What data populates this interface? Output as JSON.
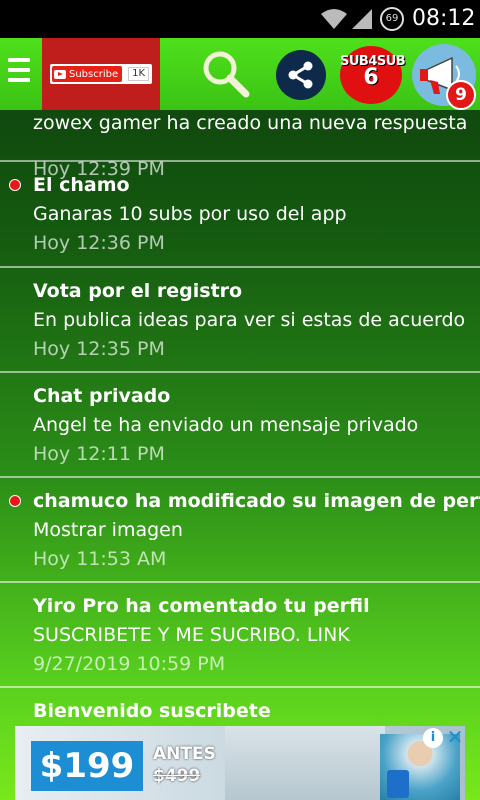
{
  "status_bar": {
    "battery": "69",
    "time": "08:12"
  },
  "toolbar": {
    "subscribe_label": "Subscribe",
    "subscribe_count": "1K",
    "sub4sub_line1": "SUB4SUB",
    "sub4sub_line2": "6",
    "notifications_count": "9"
  },
  "notifications": [
    {
      "title": "",
      "message": "zowex gamer ha creado una nueva respuesta",
      "time": "Hoy 12:39 PM",
      "unread": false
    },
    {
      "title": "El chamo",
      "message": "Ganaras 10 subs por uso del app",
      "time": "Hoy 12:36 PM",
      "unread": true
    },
    {
      "title": "Vota por el registro",
      "message": "En publica ideas para ver si estas de acuerdo",
      "time": "Hoy 12:35 PM",
      "unread": false
    },
    {
      "title": "Chat privado",
      "message": "Angel te ha enviado un mensaje privado",
      "time": "Hoy 12:11 PM",
      "unread": false
    },
    {
      "title": "chamuco ha modificado su imagen de perfil",
      "message": "Mostrar imagen",
      "time": "Hoy 11:53 AM",
      "unread": true
    },
    {
      "title": "Yiro Pro ha comentado tu perfil",
      "message": "SUSCRIBETE Y ME SUCRIBO. LINK",
      "time": "9/27/2019 10:59 PM",
      "unread": false
    },
    {
      "title": "Bienvenido suscribete",
      "message": "",
      "time": "",
      "unread": false
    }
  ],
  "ad": {
    "price": "$199",
    "antes_label": "ANTES",
    "old_price": "$499"
  },
  "colors": {
    "toolbar_green": "#46d418",
    "unread_dot": "#e81818",
    "ad_blue": "#1d8ed4"
  }
}
